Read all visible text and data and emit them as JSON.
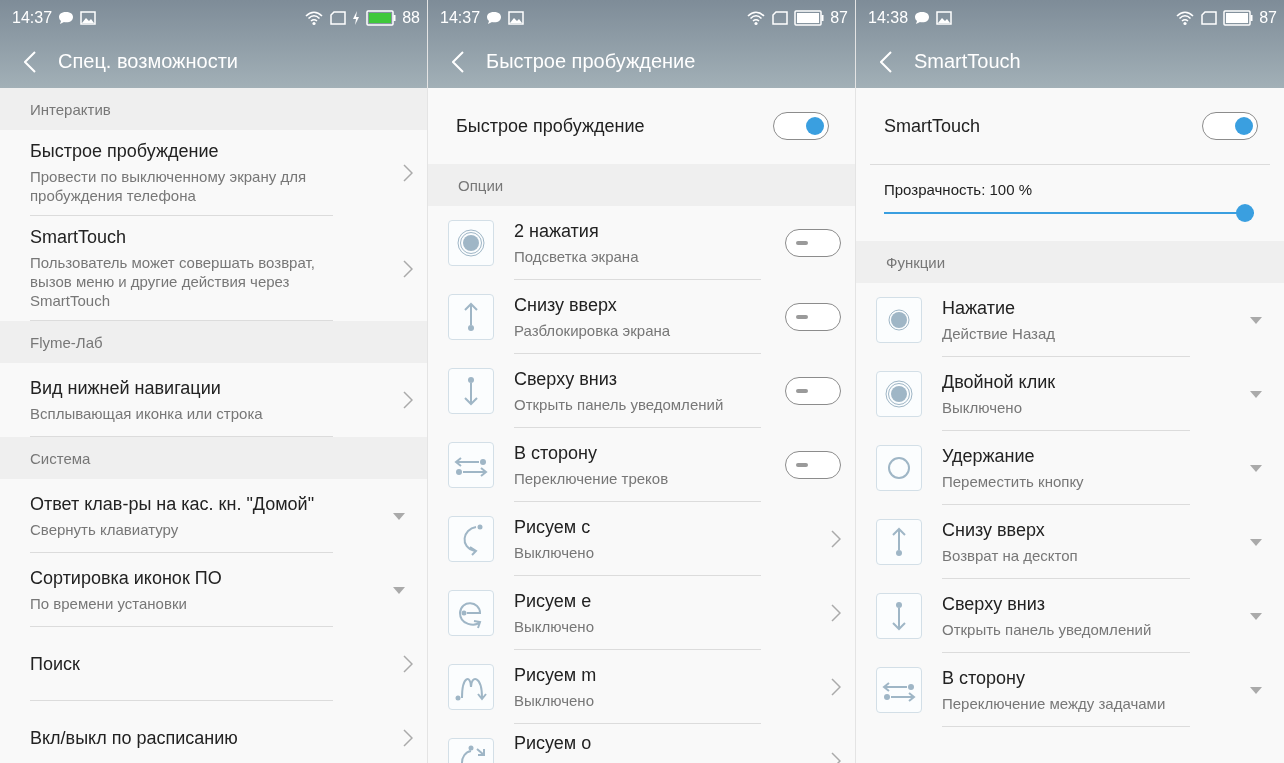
{
  "screens": [
    {
      "status_bar": {
        "time": "14:37",
        "battery": "88",
        "charging": true
      },
      "title": "Спец. возможности",
      "rows": [
        {
          "kind": "section",
          "title": "Интерактив"
        },
        {
          "kind": "link",
          "title": "Быстрое пробуждение",
          "subtitle": "Провести по выключенному экрану для пробуждения телефона"
        },
        {
          "kind": "link",
          "title": "SmartTouch",
          "subtitle": "Пользователь может совершать возврат, вызов меню и другие действия через SmartTouch"
        },
        {
          "kind": "section",
          "title": "Flyme-Лаб"
        },
        {
          "kind": "link",
          "title": "Вид нижней навигации",
          "subtitle": "Всплывающая иконка или строка"
        },
        {
          "kind": "section",
          "title": "Система"
        },
        {
          "kind": "choice",
          "title": "Ответ клав-ры на кас. кн. \"Домой\"",
          "subtitle": "Свернуть клавиатуру"
        },
        {
          "kind": "choice",
          "title": "Сортировка иконок ПО",
          "subtitle": "По времени установки"
        },
        {
          "kind": "link",
          "title": "Поиск"
        },
        {
          "kind": "link",
          "title": "Вкл/выкл по расписанию"
        }
      ]
    },
    {
      "status_bar": {
        "time": "14:37",
        "battery": "87",
        "charging": false
      },
      "title": "Быстрое пробуждение",
      "rows": [
        {
          "kind": "toggle",
          "title": "Быстрое пробуждение",
          "on": true
        },
        {
          "kind": "section",
          "title": "Опции"
        },
        {
          "kind": "switch",
          "title": "2 нажатия",
          "subtitle": "Подсветка экрана",
          "on": false
        },
        {
          "kind": "switch",
          "title": "Снизу вверх",
          "subtitle": "Разблокировка экрана",
          "on": false
        },
        {
          "kind": "switch",
          "title": "Сверху вниз",
          "subtitle": "Открыть панель уведомлений",
          "on": false
        },
        {
          "kind": "switch",
          "title": "В сторону",
          "subtitle": "Переключение треков",
          "on": false
        },
        {
          "kind": "link",
          "title": "Рисуем c",
          "subtitle": "Выключено"
        },
        {
          "kind": "link",
          "title": "Рисуем e",
          "subtitle": "Выключено"
        },
        {
          "kind": "link",
          "title": "Рисуем m",
          "subtitle": "Выключено"
        },
        {
          "kind": "link",
          "title": "Рисуем o"
        }
      ]
    },
    {
      "status_bar": {
        "time": "14:38",
        "battery": "87",
        "charging": false
      },
      "title": "SmartTouch",
      "rows": [
        {
          "kind": "toggle",
          "title": "SmartTouch",
          "on": true
        },
        {
          "kind": "slider",
          "title": "Прозрачность: 100 %",
          "level": 1
        },
        {
          "kind": "section",
          "title": "Функции"
        },
        {
          "kind": "choice",
          "title": "Нажатие",
          "subtitle": "Действие Назад"
        },
        {
          "kind": "choice",
          "title": "Двойной клик",
          "subtitle": "Выключено"
        },
        {
          "kind": "choice",
          "title": "Удержание",
          "subtitle": "Переместить кнопку"
        },
        {
          "kind": "choice",
          "title": "Снизу вверх",
          "subtitle": "Возврат на десктоп"
        },
        {
          "kind": "choice",
          "title": "Сверху вниз",
          "subtitle": "Открыть панель уведомлений"
        },
        {
          "kind": "choice",
          "title": "В сторону",
          "subtitle": "Переключение между задачами"
        }
      ]
    }
  ]
}
